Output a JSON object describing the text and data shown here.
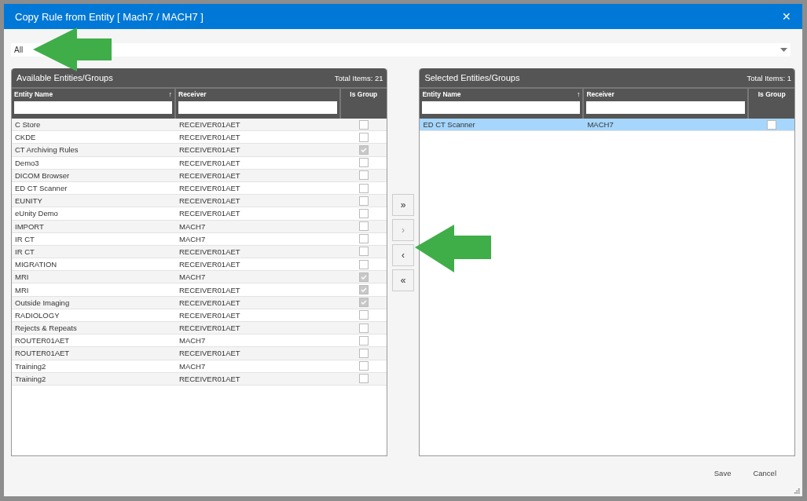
{
  "window": {
    "title": "Copy Rule from Entity [ Mach7 / MACH7 ]",
    "close": "✕"
  },
  "filter": {
    "value": "All"
  },
  "available": {
    "title": "Available Entities/Groups",
    "total": "Total Items: 21",
    "columns": [
      {
        "label": "Entity Name",
        "sort": "↑"
      },
      {
        "label": "Receiver"
      },
      {
        "label": "Is Group"
      }
    ],
    "rows": [
      {
        "name": "C Store",
        "receiver": "RECEIVER01AET",
        "is_group": false,
        "selected": false
      },
      {
        "name": "CKDE",
        "receiver": "RECEIVER01AET",
        "is_group": false,
        "selected": false
      },
      {
        "name": "CT Archiving Rules",
        "receiver": "RECEIVER01AET",
        "is_group": true,
        "selected": false
      },
      {
        "name": "Demo3",
        "receiver": "RECEIVER01AET",
        "is_group": false,
        "selected": false
      },
      {
        "name": "DICOM Browser",
        "receiver": "RECEIVER01AET",
        "is_group": false,
        "selected": false
      },
      {
        "name": "ED CT Scanner",
        "receiver": "RECEIVER01AET",
        "is_group": false,
        "selected": false
      },
      {
        "name": "EUNITY",
        "receiver": "RECEIVER01AET",
        "is_group": false,
        "selected": false
      },
      {
        "name": "eUnity Demo",
        "receiver": "RECEIVER01AET",
        "is_group": false,
        "selected": false
      },
      {
        "name": "IMPORT",
        "receiver": "MACH7",
        "is_group": false,
        "selected": false
      },
      {
        "name": "IR CT",
        "receiver": "MACH7",
        "is_group": false,
        "selected": false
      },
      {
        "name": "IR CT",
        "receiver": "RECEIVER01AET",
        "is_group": false,
        "selected": false
      },
      {
        "name": "MIGRATION",
        "receiver": "RECEIVER01AET",
        "is_group": false,
        "selected": false
      },
      {
        "name": "MRI",
        "receiver": "MACH7",
        "is_group": true,
        "selected": false
      },
      {
        "name": "MRI",
        "receiver": "RECEIVER01AET",
        "is_group": true,
        "selected": false
      },
      {
        "name": "Outside Imaging",
        "receiver": "RECEIVER01AET",
        "is_group": true,
        "selected": false
      },
      {
        "name": "RADIOLOGY",
        "receiver": "RECEIVER01AET",
        "is_group": false,
        "selected": false
      },
      {
        "name": "Rejects & Repeats",
        "receiver": "RECEIVER01AET",
        "is_group": false,
        "selected": false
      },
      {
        "name": "ROUTER01AET",
        "receiver": "MACH7",
        "is_group": false,
        "selected": false
      },
      {
        "name": "ROUTER01AET",
        "receiver": "RECEIVER01AET",
        "is_group": false,
        "selected": false
      },
      {
        "name": "Training2",
        "receiver": "MACH7",
        "is_group": false,
        "selected": false
      },
      {
        "name": "Training2",
        "receiver": "RECEIVER01AET",
        "is_group": false,
        "selected": false
      }
    ]
  },
  "transfer_buttons": [
    {
      "label": "»",
      "disabled": false
    },
    {
      "label": "›",
      "disabled": true
    },
    {
      "label": "‹",
      "disabled": false
    },
    {
      "label": "«",
      "disabled": false
    }
  ],
  "selected": {
    "title": "Selected Entities/Groups",
    "total": "Total Items: 1",
    "columns": [
      {
        "label": "Entity Name",
        "sort": "↑"
      },
      {
        "label": "Receiver"
      },
      {
        "label": "Is Group"
      }
    ],
    "rows": [
      {
        "name": "ED CT Scanner",
        "receiver": "MACH7",
        "is_group": false,
        "selected": true
      }
    ]
  },
  "buttons": [
    "Save",
    "Cancel"
  ]
}
